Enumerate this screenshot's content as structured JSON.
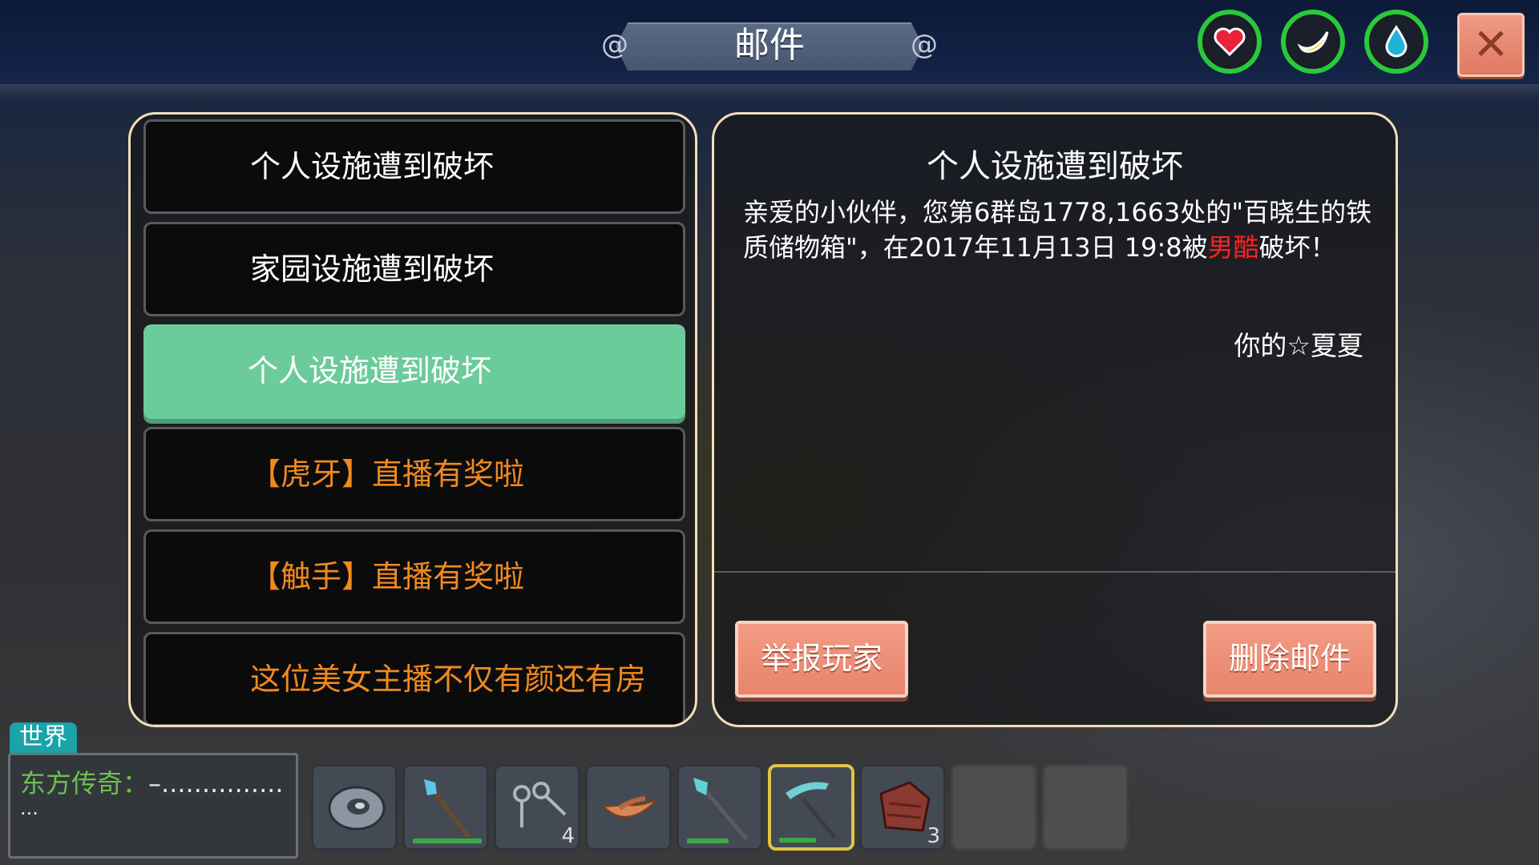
{
  "window": {
    "title": "邮件",
    "close_icon": "close-icon"
  },
  "status_icons": [
    {
      "name": "health",
      "icon": "heart-icon"
    },
    {
      "name": "hunger",
      "icon": "banana-icon"
    },
    {
      "name": "thirst",
      "icon": "water-drop-icon"
    }
  ],
  "mail_list": [
    {
      "subject": "个人设施遭到破坏",
      "style": "normal",
      "selected": false
    },
    {
      "subject": "家园设施遭到破坏",
      "style": "normal",
      "selected": false
    },
    {
      "subject": "个人设施遭到破坏",
      "style": "normal",
      "selected": true
    },
    {
      "subject": "【虎牙】直播有奖啦",
      "style": "orange",
      "selected": false
    },
    {
      "subject": "【触手】直播有奖啦",
      "style": "orange",
      "selected": false
    },
    {
      "subject": "这位美女主播不仅有颜还有房",
      "style": "orange",
      "selected": false
    }
  ],
  "mail_detail": {
    "title": "个人设施遭到破坏",
    "body_part1": "亲爱的小伙伴，您第6群岛1778,1663处的\"百晓生的铁质储物箱\"，在2017年11月13日 19:8被",
    "body_highlight": "男酷",
    "body_part2": "破坏！",
    "signature": "你的☆夏夏"
  },
  "buttons": {
    "report": "举报玩家",
    "delete": "删除邮件"
  },
  "chat": {
    "channel_tab": "世界",
    "sender": "东方传奇：",
    "message": "–...............",
    "continuation": "..."
  },
  "hotbar": [
    {
      "item": "shield-item-icon",
      "qty": "",
      "durability": null,
      "selected": false
    },
    {
      "item": "crystal-staff-icon",
      "qty": "",
      "durability": 0.85,
      "selected": false
    },
    {
      "item": "keys-icon",
      "qty": "4",
      "durability": null,
      "selected": false
    },
    {
      "item": "wooden-boat-icon",
      "qty": "",
      "durability": null,
      "selected": false
    },
    {
      "item": "crystal-spear-icon",
      "qty": "",
      "durability": 0.6,
      "selected": false
    },
    {
      "item": "crystal-pickaxe-icon",
      "qty": "",
      "durability": 0.5,
      "selected": true
    },
    {
      "item": "leather-armor-icon",
      "qty": "3",
      "durability": null,
      "selected": false
    },
    {
      "item": "",
      "qty": "",
      "durability": null,
      "selected": false
    },
    {
      "item": "",
      "qty": "",
      "durability": null,
      "selected": false
    }
  ],
  "colors": {
    "selected_mail": "#6ccb9b",
    "orange_text": "#f08a1e",
    "highlight_red": "#ff2020",
    "status_ring": "#29c93a",
    "button_salmon": "#e8846d"
  }
}
